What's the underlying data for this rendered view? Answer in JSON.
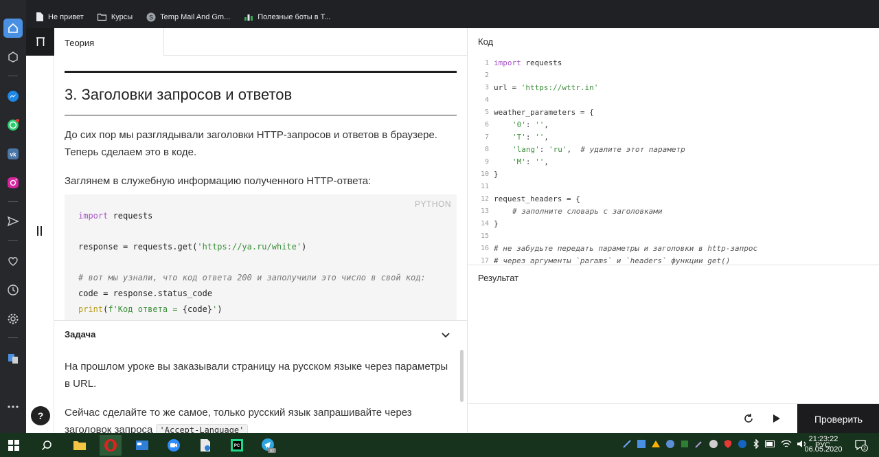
{
  "bookmarks": [
    {
      "label": "Не привет",
      "icon": "file-icon"
    },
    {
      "label": "Курсы",
      "icon": "folder-icon"
    },
    {
      "label": "Temp Mail And Gm...",
      "icon": "temp-mail-icon"
    },
    {
      "label": "Полезные боты в Т...",
      "icon": "chart-icon"
    }
  ],
  "sidebar": {
    "items": [
      "home-icon",
      "cube-icon",
      "messenger-icon",
      "whatsapp-icon",
      "vk-icon",
      "instagram-icon",
      "send-icon",
      "heart-icon",
      "clock-icon",
      "gear-icon",
      "translate-icon",
      "more-icon"
    ],
    "active_color": "#4a90e2"
  },
  "lesson": {
    "help_label": "?"
  },
  "theory": {
    "tab_label": "Теория",
    "heading": "3. Заголовки запросов и ответов",
    "para1": "До сих пор мы разглядывали заголовки HTTP-запросов и ответов в браузере. Теперь сделаем это в коде.",
    "para2": "Заглянем в служебную информацию полученного HTTP-ответа:",
    "code_lang": "PYTHON",
    "code": {
      "l1_kw": "import",
      "l1_rest": " requests",
      "l2_pre": "response = requests.get(",
      "l2_str": "'https://ya.ru/white'",
      "l2_post": ")",
      "l3_comment": "# вот мы узнали, что код ответа 200 и заполучили это число в свой код:",
      "l4": "code = response.status_code",
      "l5_fn": "print",
      "l5_pre": "(",
      "l5_str": "f'Код ответа = ",
      "l5_mid": "{code}",
      "l5_end": "'",
      "l5_post": ")"
    }
  },
  "task": {
    "header": "Задача",
    "para1": "На прошлом уроке вы заказывали страницу на русском языке через параметры в URL.",
    "para2_pre": "Сейчас сделайте то же самое, только русский язык запрашивайте через заголовок запроса ",
    "para2_code": "'Accept-Language'"
  },
  "editor": {
    "title": "Код",
    "result_title": "Результат",
    "check_label": "Проверить",
    "line_numbers": [
      "1",
      "2",
      "3",
      "4",
      "5",
      "6",
      "7",
      "8",
      "9",
      "10",
      "11",
      "12",
      "13",
      "14",
      "15",
      "16",
      "17"
    ],
    "lines": {
      "l1_kw": "import",
      "l1_rest": " requests",
      "l3_pre": "url = ",
      "l3_str": "'https://wttr.in'",
      "l5": "weather_parameters = {",
      "l6_key": "'0'",
      "l6_mid": ": ",
      "l6_val": "''",
      "l6_end": ",",
      "l7_key": "'T'",
      "l7_mid": ": ",
      "l7_val": "''",
      "l7_end": ",",
      "l8_key": "'lang'",
      "l8_mid": ": ",
      "l8_val": "'ru'",
      "l8_end": ",  ",
      "l8_comment": "# удалите этот параметр",
      "l9_key": "'M'",
      "l9_mid": ": ",
      "l9_val": "''",
      "l9_end": ",",
      "l10": "}",
      "l12": "request_headers = {",
      "l13_comment": "# заполните словарь с заголовками",
      "l14": "}",
      "l16_comment": "# не забудьте передать параметры и заголовки в http-запрос",
      "l17_comment": "# через аргументы `params` и `headers` функции get()"
    }
  },
  "taskbar": {
    "time": "21:23:22",
    "date": "06.05.2020",
    "lang": "РУС",
    "notification_count": "2",
    "telegram_badge": "82"
  }
}
